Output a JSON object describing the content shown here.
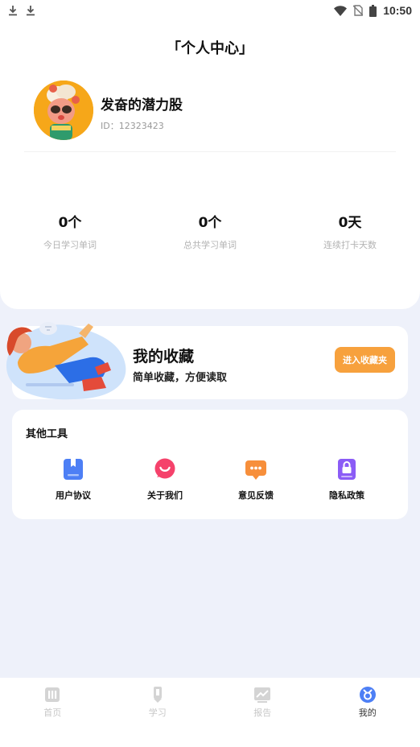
{
  "status_bar": {
    "time": "10:50",
    "icons": [
      "download-icon",
      "download-icon",
      "wifi-icon",
      "no-sim-icon",
      "battery-icon"
    ]
  },
  "header": {
    "title": "「个人中心」"
  },
  "profile": {
    "name": "发奋的潜力股",
    "id_text": "ID：12323423"
  },
  "stats": [
    {
      "value": "0个",
      "label": "今日学习单词"
    },
    {
      "value": "0个",
      "label": "总共学习单词"
    },
    {
      "value": "0天",
      "label": "连续打卡天数"
    }
  ],
  "favorites": {
    "title": "我的收藏",
    "subtitle": "简单收藏，方便读取",
    "button_label": "进入收藏夹"
  },
  "tools": {
    "title": "其他工具",
    "items": [
      {
        "label": "用户协议",
        "icon": "bookmark-book-icon",
        "color": "#4d7ff5"
      },
      {
        "label": "关于我们",
        "icon": "smile-chat-icon",
        "color": "#f5426b"
      },
      {
        "label": "意见反馈",
        "icon": "chat-dots-icon",
        "color": "#f78f3b"
      },
      {
        "label": "隐私政策",
        "icon": "lock-doc-icon",
        "color": "#8b5cf6"
      }
    ]
  },
  "bottom_nav": {
    "items": [
      {
        "label": "首页",
        "icon": "home-grid-icon",
        "active": false
      },
      {
        "label": "学习",
        "icon": "pencil-icon",
        "active": false
      },
      {
        "label": "报告",
        "icon": "chart-icon",
        "active": false
      },
      {
        "label": "我的",
        "icon": "profile-icon",
        "active": true
      }
    ],
    "active_color": "#4d7ff5"
  }
}
